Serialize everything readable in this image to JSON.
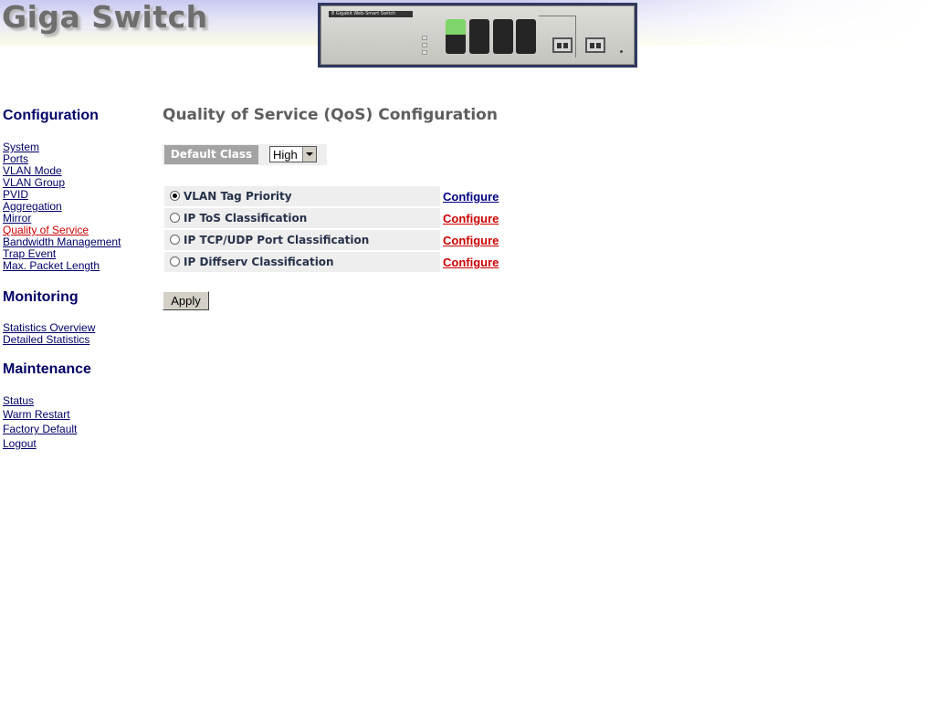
{
  "header": {
    "logo_text": "Giga Switch",
    "device_label": "8 Gigabit Web-Smart Switch"
  },
  "sidebar": {
    "configuration": {
      "title": "Configuration",
      "items": [
        {
          "label": "System"
        },
        {
          "label": "Ports"
        },
        {
          "label": "VLAN Mode"
        },
        {
          "label": "VLAN Group"
        },
        {
          "label": "PVID"
        },
        {
          "label": "Aggregation"
        },
        {
          "label": "Mirror"
        },
        {
          "label": "Quality of Service",
          "current": true
        },
        {
          "label": "Bandwidth Management"
        },
        {
          "label": "Trap Event"
        },
        {
          "label": "Max. Packet Length"
        }
      ]
    },
    "monitoring": {
      "title": "Monitoring",
      "items": [
        {
          "label": "Statistics Overview"
        },
        {
          "label": "Detailed Statistics"
        }
      ]
    },
    "maintenance": {
      "title": "Maintenance",
      "items": [
        {
          "label": "Status"
        },
        {
          "label": "Warm Restart"
        },
        {
          "label": "Factory Default"
        },
        {
          "label": "Logout"
        }
      ]
    }
  },
  "main": {
    "title": "Quality of Service (QoS) Configuration",
    "default_class_label": "Default Class",
    "default_class_value": "High",
    "options": [
      {
        "label": "VLAN Tag Priority",
        "checked": true,
        "link": "Configure",
        "link_color": "#000080"
      },
      {
        "label": "IP ToS Classification",
        "checked": false,
        "link": "Configure",
        "link_color": "#cc0000"
      },
      {
        "label": "IP TCP/UDP Port Classification",
        "checked": false,
        "link": "Configure",
        "link_color": "#cc0000"
      },
      {
        "label": "IP Diffserv Classification",
        "checked": false,
        "link": "Configure",
        "link_color": "#cc0000"
      }
    ],
    "apply_label": "Apply"
  }
}
